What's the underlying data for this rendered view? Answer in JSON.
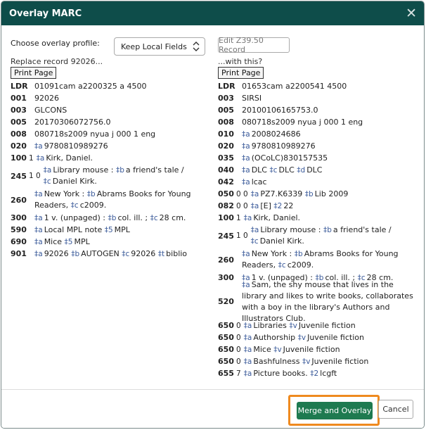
{
  "dialog": {
    "title": "Overlay MARC",
    "profile_label": "Choose overlay profile:",
    "profile_value": "Keep Local Fields",
    "edit_z3950_label": "Edit Z39.50 Record",
    "left_caption": "Replace record 92026...",
    "right_caption": "...with this?",
    "print_label": "Print Page",
    "merge_label": "Merge and Overlay",
    "cancel_label": "Cancel"
  },
  "left_record": [
    {
      "tag": "LDR",
      "ind": "",
      "parts": [
        {
          "t": "01091cam a2200325 a 4500"
        }
      ]
    },
    {
      "tag": "001",
      "ind": "",
      "parts": [
        {
          "t": "92026"
        }
      ]
    },
    {
      "tag": "003",
      "ind": "",
      "parts": [
        {
          "t": "GLCONS"
        }
      ]
    },
    {
      "tag": "005",
      "ind": "",
      "parts": [
        {
          "t": "20170306072756.0"
        }
      ]
    },
    {
      "tag": "008",
      "ind": "",
      "parts": [
        {
          "t": "080718s2009 nyua j 000 1 eng"
        }
      ]
    },
    {
      "tag": "020",
      "ind": "",
      "parts": [
        {
          "s": "‡a"
        },
        {
          "t": "9780810989276"
        }
      ]
    },
    {
      "tag": "100",
      "ind": "1",
      "parts": [
        {
          "s": "‡a"
        },
        {
          "t": "Kirk, Daniel."
        }
      ]
    },
    {
      "tag": "245",
      "ind": "1 0",
      "parts": [
        {
          "s": "‡a"
        },
        {
          "t": "Library mouse :"
        },
        {
          "s": "‡b"
        },
        {
          "t": "a friend's tale /"
        },
        {
          "s": "‡c"
        },
        {
          "t": "Daniel Kirk."
        }
      ]
    },
    {
      "tag": "260",
      "ind": "",
      "parts": [
        {
          "s": "‡a"
        },
        {
          "t": "New York :"
        },
        {
          "s": "‡b"
        },
        {
          "t": "Abrams Books for Young Readers,"
        },
        {
          "s": "‡c"
        },
        {
          "t": "c2009."
        }
      ]
    },
    {
      "tag": "300",
      "ind": "",
      "parts": [
        {
          "s": "‡a"
        },
        {
          "t": "1 v. (unpaged) :"
        },
        {
          "s": "‡b"
        },
        {
          "t": "col. ill. ;"
        },
        {
          "s": "‡c"
        },
        {
          "t": "28 cm."
        }
      ]
    },
    {
      "tag": "590",
      "ind": "",
      "parts": [
        {
          "s": "‡a"
        },
        {
          "t": "Local MPL note"
        },
        {
          "s": "‡5"
        },
        {
          "t": "MPL"
        }
      ]
    },
    {
      "tag": "690",
      "ind": "",
      "parts": [
        {
          "s": "‡a"
        },
        {
          "t": "Mice"
        },
        {
          "s": "‡5"
        },
        {
          "t": "MPL"
        }
      ]
    },
    {
      "tag": "901",
      "ind": "",
      "parts": [
        {
          "s": "‡a"
        },
        {
          "t": "92026"
        },
        {
          "s": "‡b"
        },
        {
          "t": "AUTOGEN"
        },
        {
          "s": "‡c"
        },
        {
          "t": "92026"
        },
        {
          "s": "‡t"
        },
        {
          "t": "biblio"
        }
      ]
    }
  ],
  "right_record": [
    {
      "tag": "LDR",
      "ind": "",
      "parts": [
        {
          "t": "01653cam a2200541 4500"
        }
      ]
    },
    {
      "tag": "003",
      "ind": "",
      "parts": [
        {
          "t": "SIRSI"
        }
      ]
    },
    {
      "tag": "005",
      "ind": "",
      "parts": [
        {
          "t": "20100106165753.0"
        }
      ]
    },
    {
      "tag": "008",
      "ind": "",
      "parts": [
        {
          "t": "080718s2009 nyua j 000 1 eng"
        }
      ]
    },
    {
      "tag": "010",
      "ind": "",
      "parts": [
        {
          "s": "‡a"
        },
        {
          "t": "2008024686"
        }
      ]
    },
    {
      "tag": "020",
      "ind": "",
      "parts": [
        {
          "s": "‡a"
        },
        {
          "t": "9780810989276"
        }
      ]
    },
    {
      "tag": "035",
      "ind": "",
      "parts": [
        {
          "s": "‡a"
        },
        {
          "t": "(OCoLC)830157535"
        }
      ]
    },
    {
      "tag": "040",
      "ind": "",
      "parts": [
        {
          "s": "‡a"
        },
        {
          "t": "DLC"
        },
        {
          "s": "‡c"
        },
        {
          "t": "DLC"
        },
        {
          "s": "‡d"
        },
        {
          "t": "DLC"
        }
      ]
    },
    {
      "tag": "042",
      "ind": "",
      "parts": [
        {
          "s": "‡a"
        },
        {
          "t": "lcac"
        }
      ]
    },
    {
      "tag": "050",
      "ind": "0 0",
      "parts": [
        {
          "s": "‡a"
        },
        {
          "t": "PZ7.K6339"
        },
        {
          "s": "‡b"
        },
        {
          "t": "Lib 2009"
        }
      ]
    },
    {
      "tag": "082",
      "ind": "0 0",
      "parts": [
        {
          "s": "‡a"
        },
        {
          "t": "[E]"
        },
        {
          "s": "‡2"
        },
        {
          "t": "22"
        }
      ]
    },
    {
      "tag": "100",
      "ind": "1",
      "parts": [
        {
          "s": "‡a"
        },
        {
          "t": "Kirk, Daniel."
        }
      ]
    },
    {
      "tag": "245",
      "ind": "1 0",
      "parts": [
        {
          "s": "‡a"
        },
        {
          "t": "Library mouse :"
        },
        {
          "s": "‡b"
        },
        {
          "t": "a friend's tale /"
        },
        {
          "s": "‡c"
        },
        {
          "t": "Daniel Kirk."
        }
      ]
    },
    {
      "tag": "260",
      "ind": "",
      "parts": [
        {
          "s": "‡a"
        },
        {
          "t": "New York :"
        },
        {
          "s": "‡b"
        },
        {
          "t": "Abrams Books for Young Readers,"
        },
        {
          "s": "‡c"
        },
        {
          "t": "c2009."
        }
      ]
    },
    {
      "tag": "300",
      "ind": "",
      "parts": [
        {
          "s": "‡a"
        },
        {
          "t": "1 v. (unpaged) :"
        },
        {
          "s": "‡b"
        },
        {
          "t": "col. ill. ;"
        },
        {
          "s": "‡c"
        },
        {
          "t": "28 cm."
        }
      ]
    },
    {
      "tag": "520",
      "ind": "",
      "parts": [
        {
          "s": "‡a"
        },
        {
          "t": "Sam, the shy mouse that lives in the library and likes to write books, collaborates with a boy in the library's Authors and Illustrators Club."
        }
      ]
    },
    {
      "tag": "650",
      "ind": "0",
      "parts": [
        {
          "s": "‡a"
        },
        {
          "t": "Libraries"
        },
        {
          "s": "‡v"
        },
        {
          "t": "Juvenile fiction"
        }
      ]
    },
    {
      "tag": "650",
      "ind": "0",
      "parts": [
        {
          "s": "‡a"
        },
        {
          "t": "Authorship"
        },
        {
          "s": "‡v"
        },
        {
          "t": "Juvenile fiction"
        }
      ]
    },
    {
      "tag": "650",
      "ind": "0",
      "parts": [
        {
          "s": "‡a"
        },
        {
          "t": "Mice"
        },
        {
          "s": "‡v"
        },
        {
          "t": "Juvenile fiction"
        }
      ]
    },
    {
      "tag": "650",
      "ind": "0",
      "parts": [
        {
          "s": "‡a"
        },
        {
          "t": "Bashfulness"
        },
        {
          "s": "‡v"
        },
        {
          "t": "Juvenile fiction"
        }
      ]
    },
    {
      "tag": "655",
      "ind": "7",
      "parts": [
        {
          "s": "‡a"
        },
        {
          "t": "Picture books."
        },
        {
          "s": "‡2"
        },
        {
          "t": "lcgft"
        }
      ]
    }
  ]
}
